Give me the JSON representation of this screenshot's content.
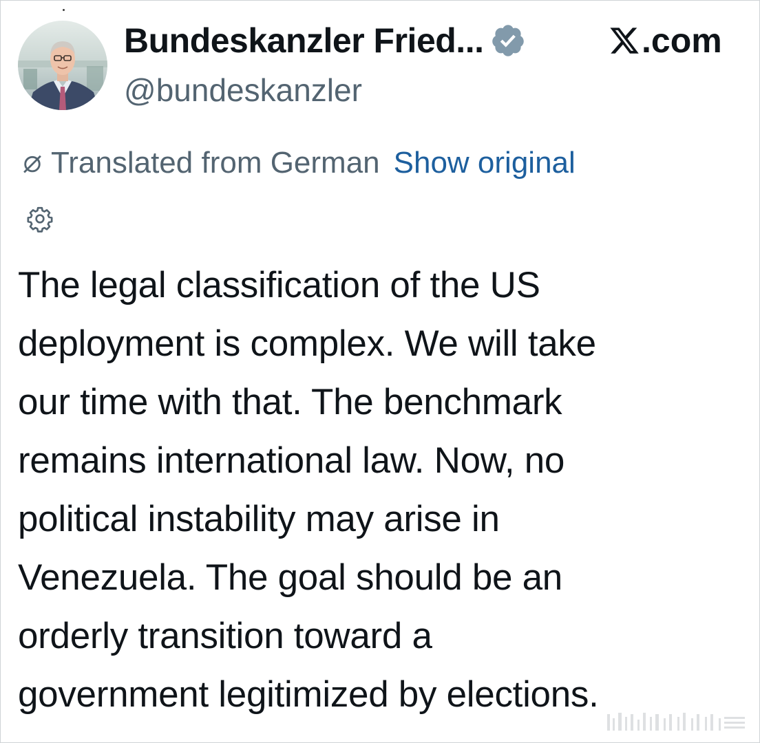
{
  "header": {
    "display_name": "Bundeskanzler Fried...",
    "handle": "@bundeskanzler",
    "site_label": ".com",
    "verified_badge_color": "#829aab"
  },
  "translation": {
    "label": "Translated from German",
    "show_original": "Show original"
  },
  "tweet": {
    "lines": [
      "The legal classification of the US",
      "deployment is complex. We will take",
      "our time with that. The benchmark",
      "remains international law. Now, no",
      "political instability may arise in",
      "Venezuela. The goal should be an",
      "orderly transition toward a",
      "government legitimized by elections."
    ]
  },
  "icons": {
    "avatar": "avatar-photo",
    "verified": "verified-badge-icon",
    "x_logo": "x-logo-icon",
    "translate": "translate-icon",
    "settings": "gear-icon"
  },
  "colors": {
    "text_primary": "#0f1419",
    "text_secondary": "#536471",
    "link": "#1d5f9e"
  }
}
